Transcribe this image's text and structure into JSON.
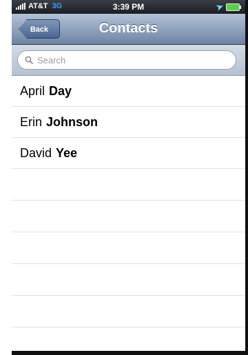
{
  "status_bar": {
    "carrier": "AT&T",
    "network": "3G",
    "time": "3:39 PM"
  },
  "nav": {
    "back_label": "Back",
    "title": "Contacts"
  },
  "search": {
    "placeholder": "Search"
  },
  "contacts": [
    {
      "first": "April",
      "last": "Day"
    },
    {
      "first": "Erin",
      "last": "Johnson"
    },
    {
      "first": "David",
      "last": "Yee"
    }
  ],
  "colors": {
    "nav_bar": "#6d84a4",
    "network": "#3aa2ff",
    "battery": "#5ad04b"
  }
}
